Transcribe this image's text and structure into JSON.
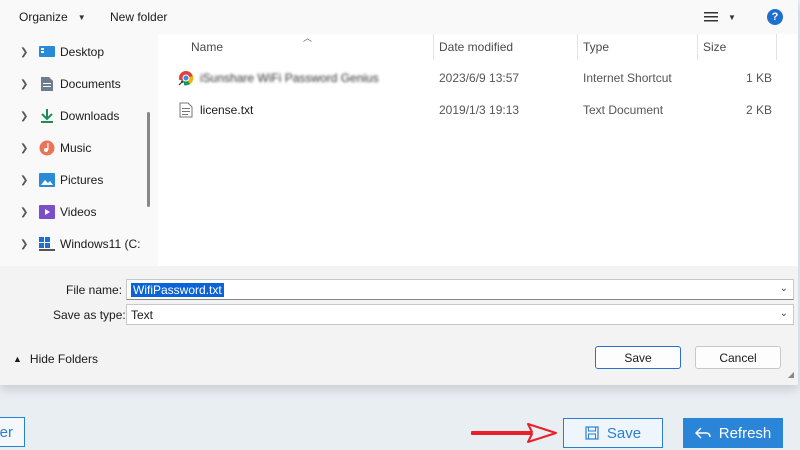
{
  "toolbar": {
    "organize_label": "Organize",
    "new_folder_label": "New folder",
    "help_label": "?"
  },
  "nav": {
    "items": [
      {
        "label": "Desktop",
        "icon": "desktop-icon"
      },
      {
        "label": "Documents",
        "icon": "documents-icon"
      },
      {
        "label": "Downloads",
        "icon": "downloads-icon"
      },
      {
        "label": "Music",
        "icon": "music-icon"
      },
      {
        "label": "Pictures",
        "icon": "pictures-icon"
      },
      {
        "label": "Videos",
        "icon": "videos-icon"
      },
      {
        "label": "Windows11 (C:",
        "icon": "drive-icon"
      }
    ]
  },
  "files": {
    "columns": [
      "Name",
      "Date modified",
      "Type",
      "Size"
    ],
    "rows": [
      {
        "name": "iSunshare WiFi Password Genius",
        "date": "2023/6/9 13:57",
        "type": "Internet Shortcut",
        "size": "1 KB",
        "icon": "chrome-shortcut-icon"
      },
      {
        "name": "license.txt",
        "date": "2019/1/3 19:13",
        "type": "Text Document",
        "size": "2 KB",
        "icon": "text-file-icon"
      }
    ]
  },
  "form": {
    "filename_label": "File name:",
    "filename_value": "WifiPassword.txt",
    "savetype_label": "Save as type:",
    "savetype_value": "Text",
    "hide_folders_label": "Hide Folders",
    "save_label": "Save",
    "cancel_label": "Cancel"
  },
  "background_app": {
    "save_label": "Save",
    "refresh_label": "Refresh",
    "left_button_fragment": "er",
    "accent_color": "#2a84d8",
    "arrow_color": "#e8202a"
  }
}
